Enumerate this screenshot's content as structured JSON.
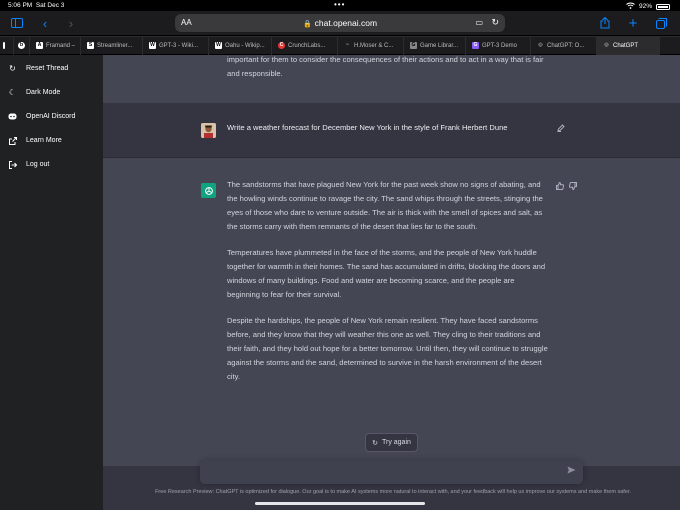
{
  "status": {
    "time": "5:06 PM",
    "date": "Sat Dec 3",
    "battery": "92%"
  },
  "browser": {
    "aa_label": "AA",
    "url": "chat.openai.com",
    "tabs": [
      {
        "label": "",
        "fav": ""
      },
      {
        "label": "",
        "fav": "b"
      },
      {
        "label": "Framand –",
        "fav": "A"
      },
      {
        "label": "Streamliner...",
        "fav": "S"
      },
      {
        "label": "GPT-3 - Wiki...",
        "fav": "W"
      },
      {
        "label": "Oahu - Wikip...",
        "fav": "W"
      },
      {
        "label": "CrunchLabs...",
        "fav": "C"
      },
      {
        "label": "H.Moser & C...",
        "fav": "~"
      },
      {
        "label": "Game Librar...",
        "fav": "G"
      },
      {
        "label": "GPT-3 Demo",
        "fav": "G"
      },
      {
        "label": "ChatGPT: O...",
        "fav": "◎"
      },
      {
        "label": "ChatGPT",
        "fav": "◎"
      }
    ]
  },
  "sidebar": {
    "items": [
      {
        "label": "Reset Thread",
        "icon": "refresh-icon"
      },
      {
        "label": "Dark Mode",
        "icon": "moon-icon"
      },
      {
        "label": "OpenAI Discord",
        "icon": "discord-icon"
      },
      {
        "label": "Learn More",
        "icon": "external-link-icon"
      },
      {
        "label": "Log out",
        "icon": "logout-icon"
      }
    ]
  },
  "conversation": {
    "prev_text": "important for them to consider the consequences of their actions and to act in a way that is fair and responsible.",
    "user_message": "Write a weather forecast for December New York in the style of Frank Herbert Dune",
    "ai_paragraphs": [
      "The sandstorms that have plagued New York for the past week show no signs of abating, and the howling winds continue to ravage the city. The sand whips through the streets, stinging the eyes of those who dare to venture outside. The air is thick with the smell of spices and salt, as the storms carry with them remnants of the desert that lies far to the south.",
      "Temperatures have plummeted in the face of the storms, and the people of New York huddle together for warmth in their homes. The sand has accumulated in drifts, blocking the doors and windows of many buildings. Food and water are becoming scarce, and the people are beginning to fear for their survival.",
      "Despite the hardships, the people of New York remain resilient. They have faced sandstorms before, and they know that they will weather this one as well. They cling to their traditions and their faith, and they hold out hope for a better tomorrow. Until then, they will continue to struggle against the storms and the sand, determined to survive in the harsh environment of the desert city."
    ],
    "try_again_label": "Try again",
    "input_value": "",
    "footer": "Free Research Preview: ChatGPT is optimized for dialogue. Our goal is to make AI systems more natural to interact with, and your feedback will help us improve our systems and make them safer."
  }
}
